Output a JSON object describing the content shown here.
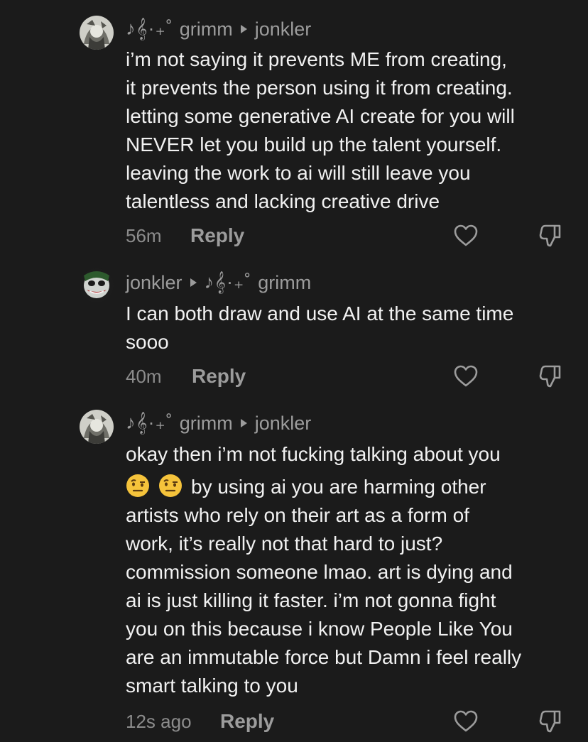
{
  "comments": [
    {
      "author_symbols": "♪𝄞·₊˚",
      "author": "grimm",
      "reply_to": "jonkler",
      "lines": [
        "i’m not saying it prevents ME from creating,",
        "it prevents the person using it from creating.",
        "letting some generative AI create for you will",
        "NEVER let you build up the talent yourself.",
        "leaving the work to ai will still leave you",
        "talentless and lacking creative drive"
      ],
      "time": "56m",
      "reply_label": "Reply"
    },
    {
      "author": "jonkler",
      "reply_to_symbols": "♪𝄞·₊˚",
      "reply_to": "grimm",
      "lines": [
        "I can both draw and use AI at the same time",
        "sooo"
      ],
      "time": "40m",
      "reply_label": "Reply"
    },
    {
      "author_symbols": "♪𝄞·₊˚",
      "author": "grimm",
      "reply_to": "jonkler",
      "lines": [
        "okay then i’m not fucking talking about you",
        "by using ai you are harming other",
        "artists who rely on their art as a form of",
        "work, it’s really not that hard to just?",
        "commission someone lmao. art is dying and",
        "ai is just killing it faster. i’m not gonna fight",
        "you on this because i know People Like You",
        "are an immutable force but Damn i feel really",
        "smart talking to you"
      ],
      "time": "12s ago",
      "reply_label": "Reply"
    }
  ],
  "icons": {
    "like": "heart-outline-icon",
    "dislike": "thumbs-down-outline-icon",
    "emoji": "face-with-raised-eyebrow-emoji"
  },
  "colors": {
    "background": "#1b1b1b",
    "text": "#f1f1f1",
    "muted": "#9c9c9c"
  }
}
